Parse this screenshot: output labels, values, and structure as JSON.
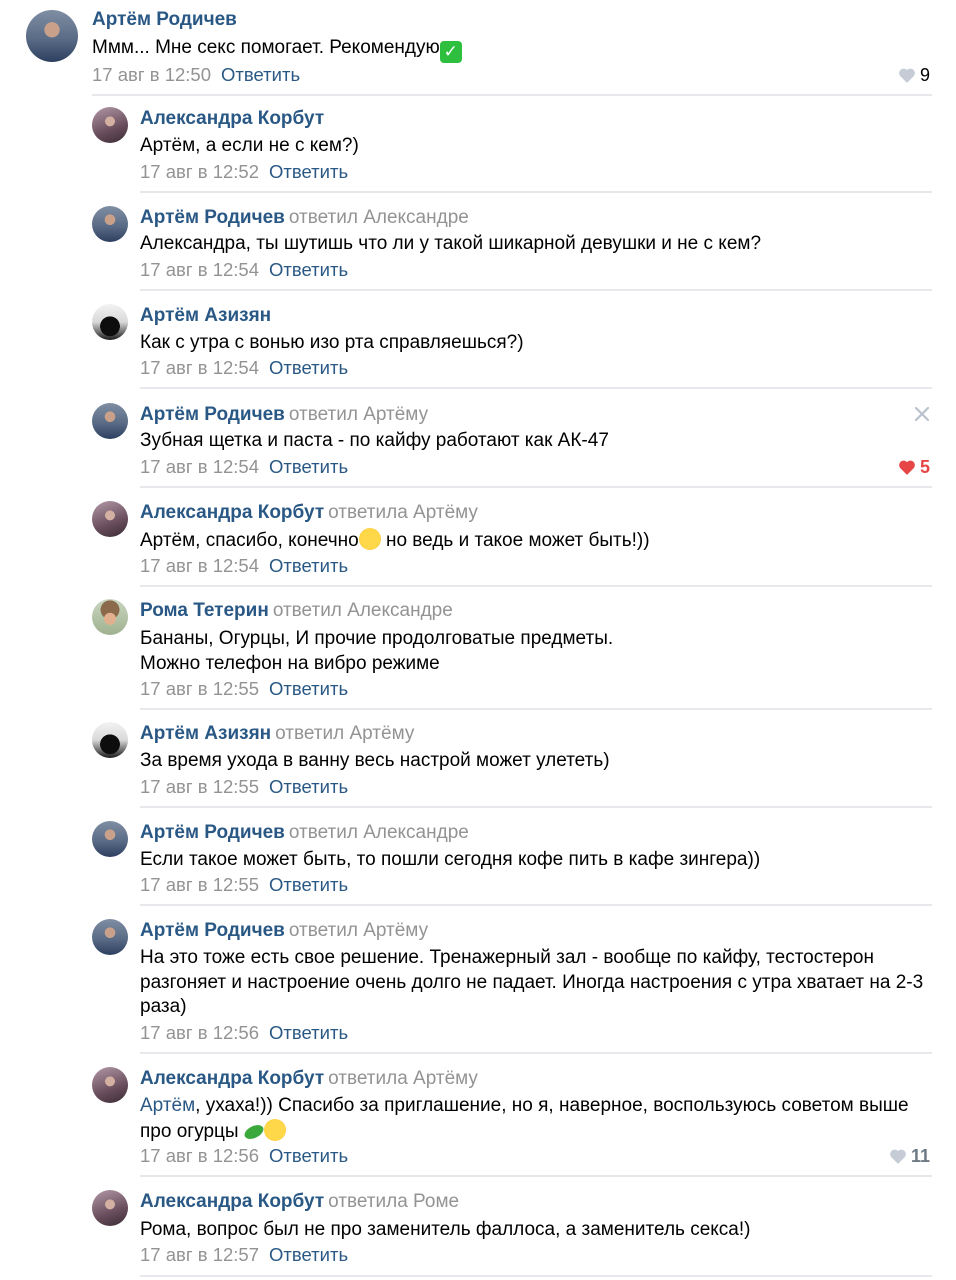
{
  "reply_label": "Ответить",
  "comments": [
    {
      "author": "Артём Родичев",
      "reply_to": "",
      "text": "Ммм... Мне секс помогает. Рекомендую",
      "date": "17 авг в 12:50",
      "likes": "9",
      "emoji": "check-mark-icon"
    },
    {
      "author": "Александра Корбут",
      "reply_to": "",
      "text": "Артём, а если не с кем?)",
      "date": "17 авг в 12:52"
    },
    {
      "author": "Артём Родичев",
      "reply_to": "ответил Александре",
      "text": "Александра, ты шутишь что ли у такой шикарной девушки и не с кем?",
      "date": "17 авг в 12:54"
    },
    {
      "author": "Артём Азизян",
      "reply_to": "",
      "text": "Как с утра с вонью изо рта справляешься?)",
      "date": "17 авг в 12:54"
    },
    {
      "author": "Артём Родичев",
      "reply_to": "ответил Артёму",
      "text": "Зубная щетка и паста - по кайфу работают как АК-47",
      "date": "17 авг в 12:54",
      "likes": "5",
      "liked": true
    },
    {
      "author": "Александра Корбут",
      "reply_to": "ответила Артёму",
      "text_before": "Артём, спасибо, конечно",
      "text_after": " но ведь и такое может быть!))",
      "date": "17 авг в 12:54"
    },
    {
      "author": "Рома Тетерин",
      "reply_to": "ответил Александре",
      "text_line1": "Бананы, Огурцы, И прочие продолговатые предметы.",
      "text_line2": "Можно телефон на вибро режиме",
      "date": "17 авг в 12:55"
    },
    {
      "author": "Артём Азизян",
      "reply_to": "ответил Артёму",
      "text": "За время ухода в ванну весь настрой может улететь)",
      "date": "17 авг в 12:55"
    },
    {
      "author": "Артём Родичев",
      "reply_to": "ответил Александре",
      "text": "Если такое может быть, то пошли сегодня кофе пить в кафе зингера))",
      "date": "17 авг в 12:55"
    },
    {
      "author": "Артём Родичев",
      "reply_to": "ответил Артёму",
      "text": "На это тоже есть свое решение. Тренажерный зал - вообще по кайфу, тестостерон разгоняет и настроение очень долго не падает. Иногда настроения с утра хватает на 2-3 раза)",
      "date": "17 авг в 12:56"
    },
    {
      "author": "Александра Корбут",
      "reply_to": "ответила Артёму",
      "mention": "Артём",
      "text": ", ухаха!)) Спасибо за приглашение, но я, наверное, воспользуюсь советом выше про огурцы",
      "date": "17 авг в 12:56",
      "likes": "11"
    },
    {
      "author": "Александра Корбут",
      "reply_to": "ответила Роме",
      "text": "Рома, вопрос был не про заменитель фаллоса, а заменитель секса!)",
      "date": "17 авг в 12:57"
    }
  ],
  "colors": {
    "link": "#2a5885",
    "muted": "#939393",
    "like_active": "#e64646",
    "divider": "#e7e8ec"
  }
}
